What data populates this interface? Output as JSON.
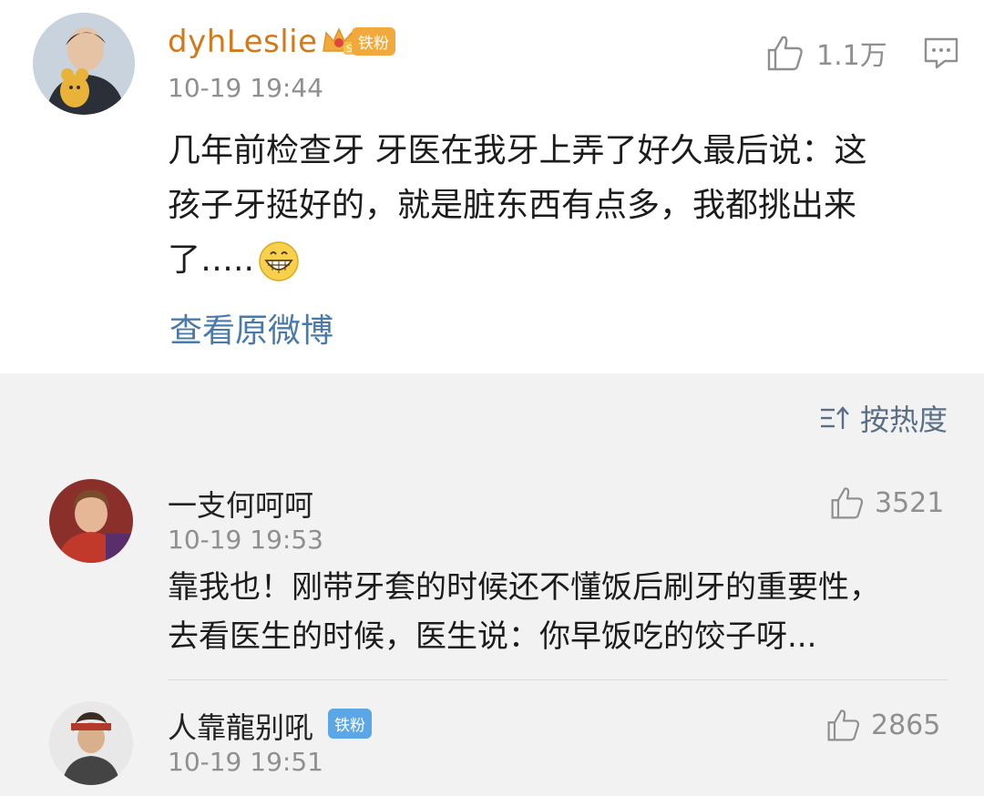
{
  "main_post": {
    "username": "dyhLeslie",
    "badge_label": "铁粉",
    "timestamp": "10-19 19:44",
    "like_count": "1.1万",
    "text_lines": [
      "几年前检查牙 牙医在我牙上弄了好久最后说：这",
      "孩子牙挺好的，就是脏东西有点多，我都挑出来",
      "了….."
    ],
    "view_original_label": "查看原微博"
  },
  "sort": {
    "label": "按热度"
  },
  "comments": [
    {
      "username": "一支何呵呵",
      "timestamp": "10-19 19:53",
      "like_count": "3521",
      "text_lines": [
        "靠我也！刚带牙套的时候还不懂饭后刷牙的重要性，",
        "去看医生的时候，医生说：你早饭吃的饺子呀..."
      ]
    },
    {
      "username": "人靠龍别吼",
      "badge_label": "铁粉",
      "timestamp": "10-19 19:51",
      "like_count": "2865"
    }
  ],
  "colors": {
    "username_gold": "#d07a1e",
    "link_blue": "#4a7aa8",
    "badge_blue": "#5aa6e6",
    "badge_orange": "#f2a93b",
    "meta_gray": "#8f8f8f"
  }
}
